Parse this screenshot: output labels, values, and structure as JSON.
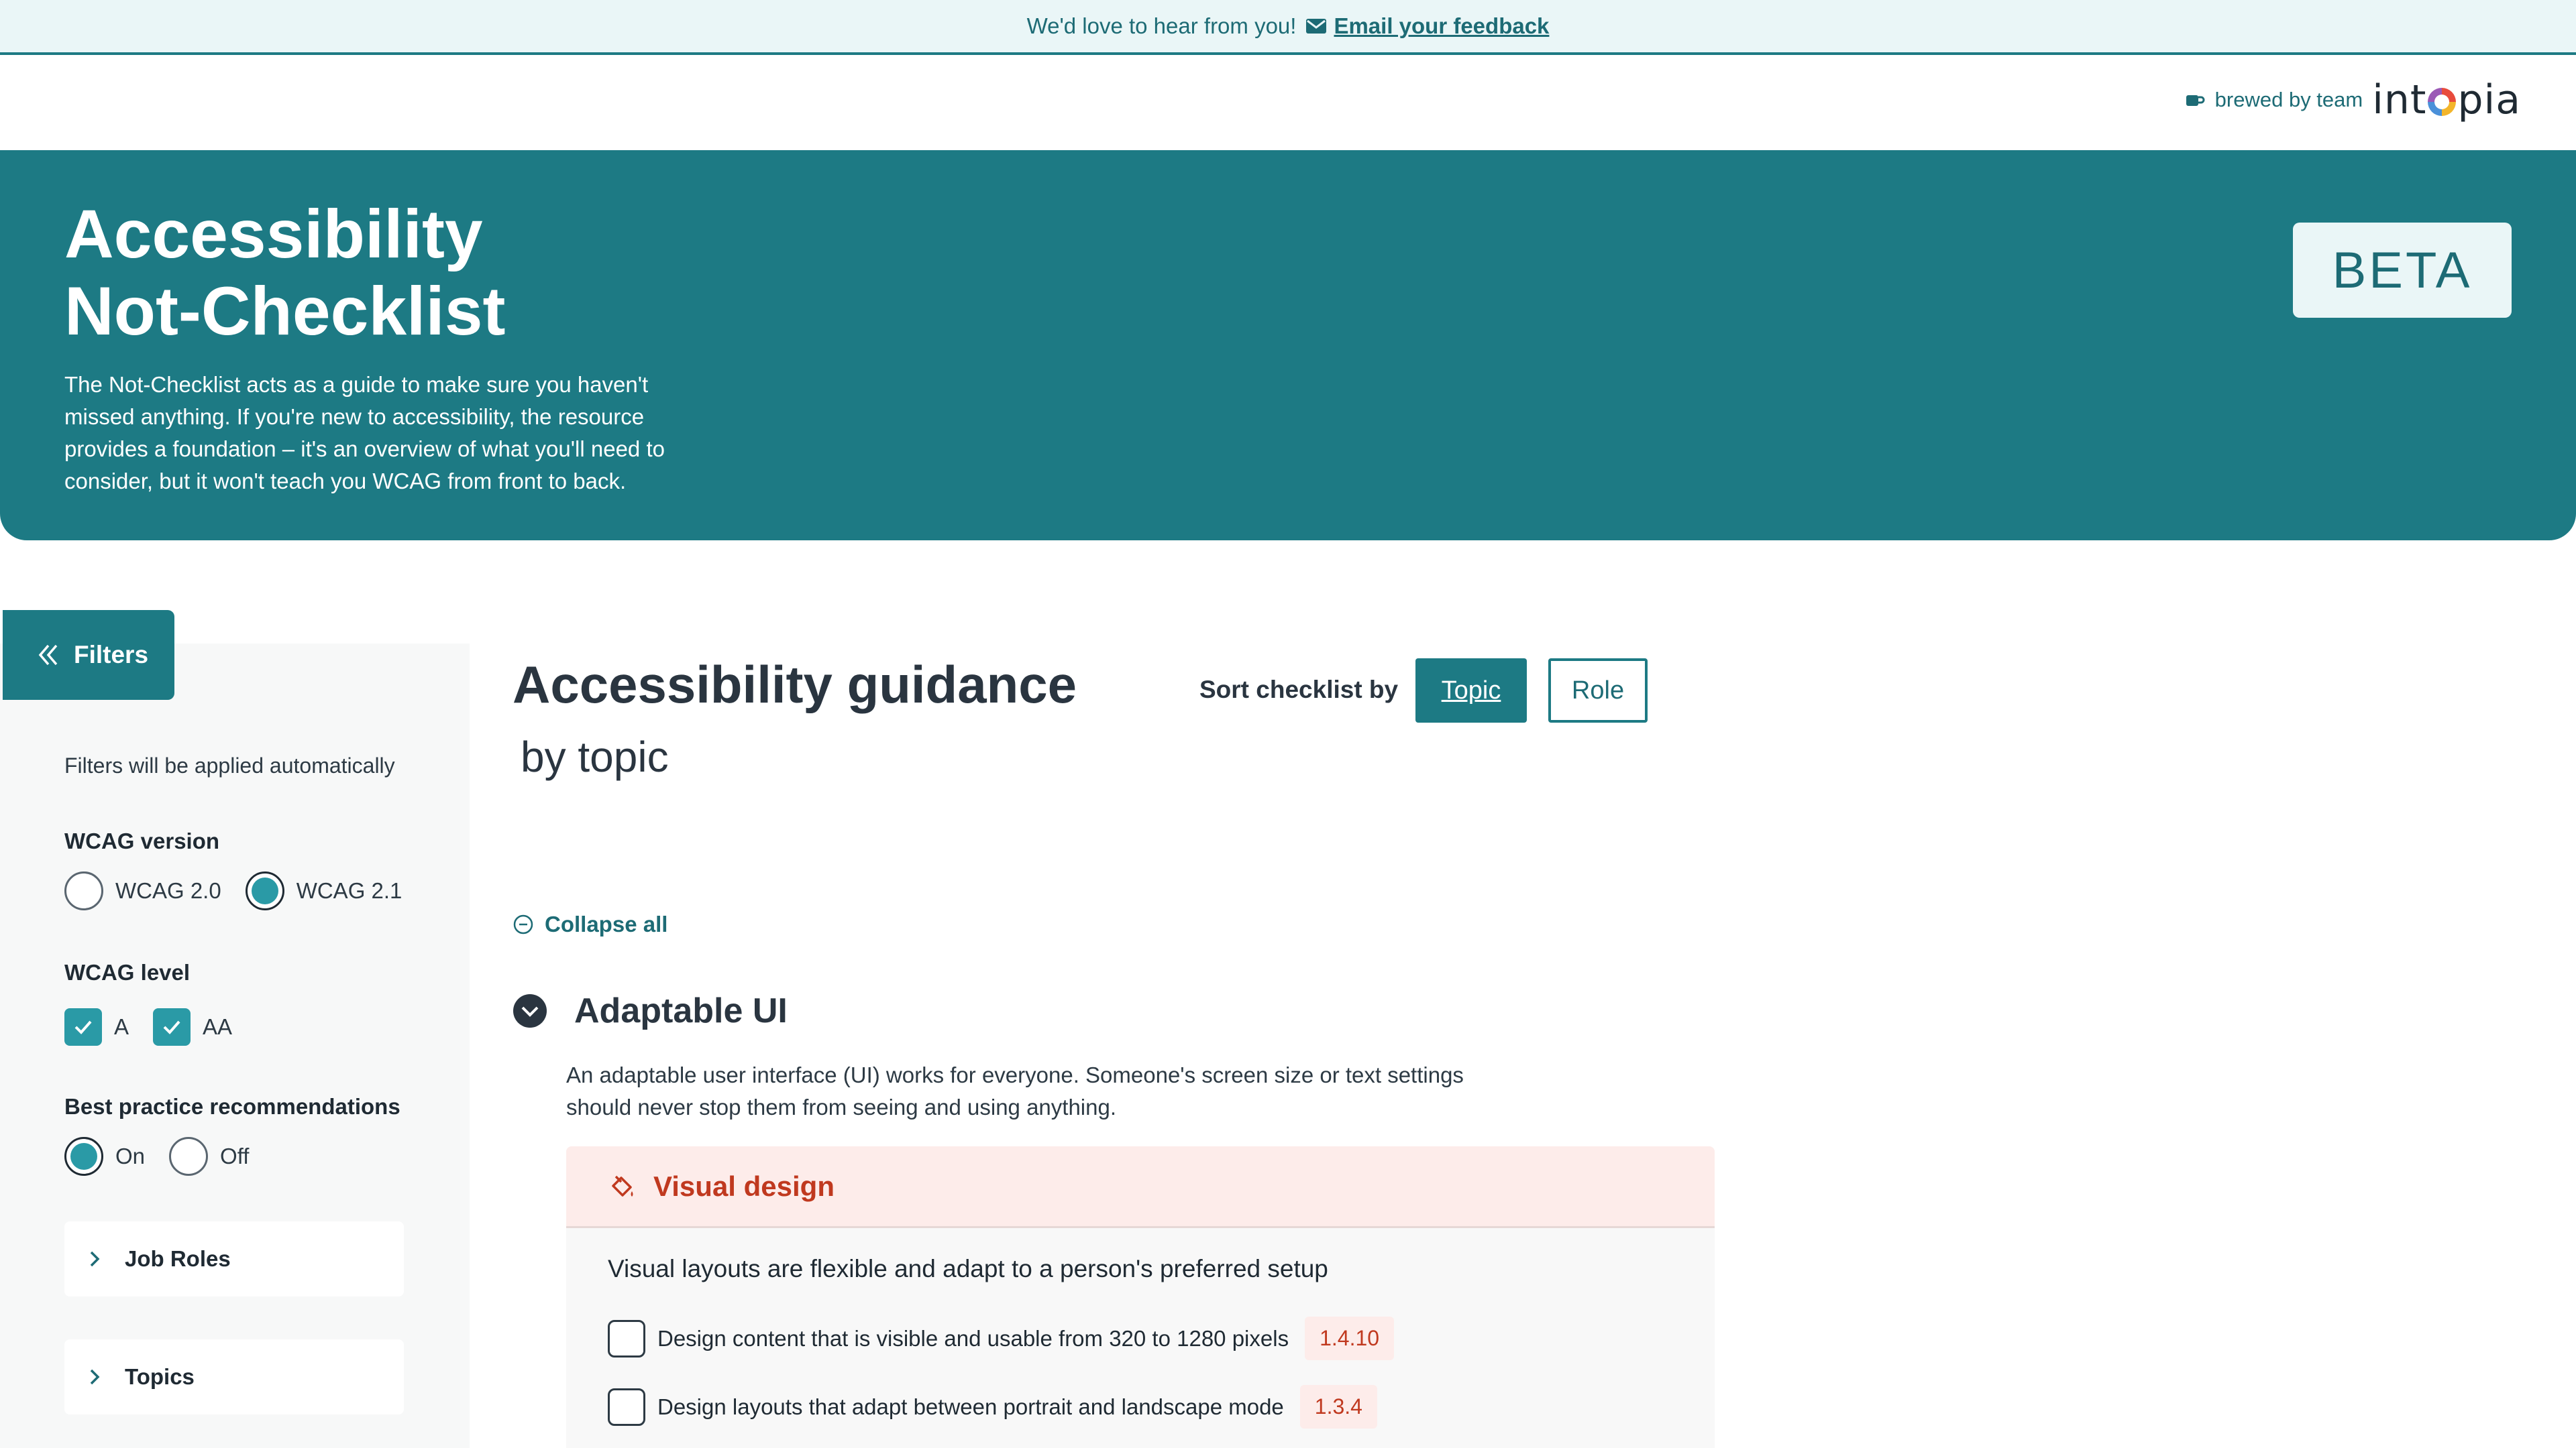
{
  "feedback": {
    "text": "We'd love to hear from you!",
    "link": "Email your feedback"
  },
  "brand": {
    "brewed": "brewed by team",
    "logo_pre": "int",
    "logo_post": "pia"
  },
  "hero": {
    "title_line1": "Accessibility",
    "title_line2": "Not-Checklist",
    "description": "The Not-Checklist acts as a guide to make sure you haven't missed anything. If you're new to accessibility, the resource provides a foundation – it's an overview of what you'll need to consider, but it won't teach you WCAG from front to back.",
    "badge": "BETA"
  },
  "sidebar": {
    "toggle_label": "Filters",
    "note": "Filters will be applied automatically",
    "wcag_version": {
      "heading": "WCAG version",
      "options": [
        "WCAG 2.0",
        "WCAG 2.1"
      ],
      "selected": "WCAG 2.1"
    },
    "wcag_level": {
      "heading": "WCAG level",
      "options": [
        "A",
        "AA"
      ],
      "checked": [
        "A",
        "AA"
      ]
    },
    "best_practice": {
      "heading": "Best practice recommendations",
      "options": [
        "On",
        "Off"
      ],
      "selected": "On"
    },
    "accordions": [
      "Job Roles",
      "Topics"
    ]
  },
  "main": {
    "title": "Accessibility guidance",
    "subtitle": "by topic",
    "sort_label": "Sort checklist by",
    "sort_options": [
      "Topic",
      "Role"
    ],
    "sort_selected": "Topic",
    "collapse_all": "Collapse all",
    "section": {
      "title": "Adaptable UI",
      "description": "An adaptable user interface (UI) works for everyone. Someone's screen size or text settings should never stop them from seeing and using anything.",
      "category": {
        "title": "Visual design",
        "lead": "Visual layouts are flexible and adapt to a person's preferred setup",
        "items": [
          {
            "text": "Design content that is visible and usable from 320 to 1280 pixels",
            "sc": "1.4.10"
          },
          {
            "text": "Design layouts that adapt between portrait and landscape mode",
            "sc": "1.3.4"
          }
        ]
      }
    }
  },
  "colors": {
    "teal": "#1d7a84",
    "teal_light": "#2a9aa6",
    "pale_teal": "#eaf6f7",
    "coral": "#c0391f",
    "coral_bg": "#fdecea"
  }
}
